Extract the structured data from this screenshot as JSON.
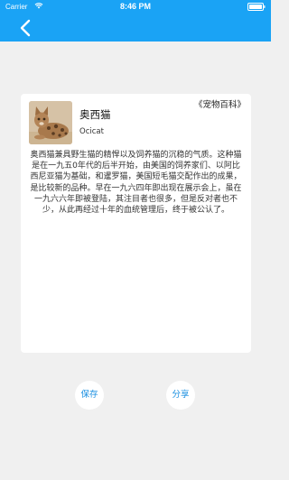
{
  "status_bar": {
    "carrier": "Carrier",
    "time": "8:46 PM",
    "wifi_icon": "wifi-icon",
    "battery_icon": "battery-icon"
  },
  "nav": {
    "back_icon": "chevron-left-icon"
  },
  "card": {
    "source": "《宠物百科》",
    "name_cn": "奥西猫",
    "name_en": "Ocicat",
    "description": "奥西猫兼具野生猫的精悍以及饲养猫的沉稳的气质。这种猫是在一九五0年代的后半开始，由美国的饲养家们、以阿比西尼亚猫为基础，和暹罗猫，美国短毛猫交配作出的成果，是比较新的品种。早在一九六四年即出现在展示会上，虽在一九六六年即被登陆，其注目者也很多，但是反对者也不少，从此再经过十年的血统管理后，终于被公认了。"
  },
  "actions": {
    "save_label": "保存",
    "share_label": "分享"
  },
  "colors": {
    "accent": "#1aa3f5",
    "background": "#f0f0f0",
    "button_text": "#1a8fe0"
  }
}
